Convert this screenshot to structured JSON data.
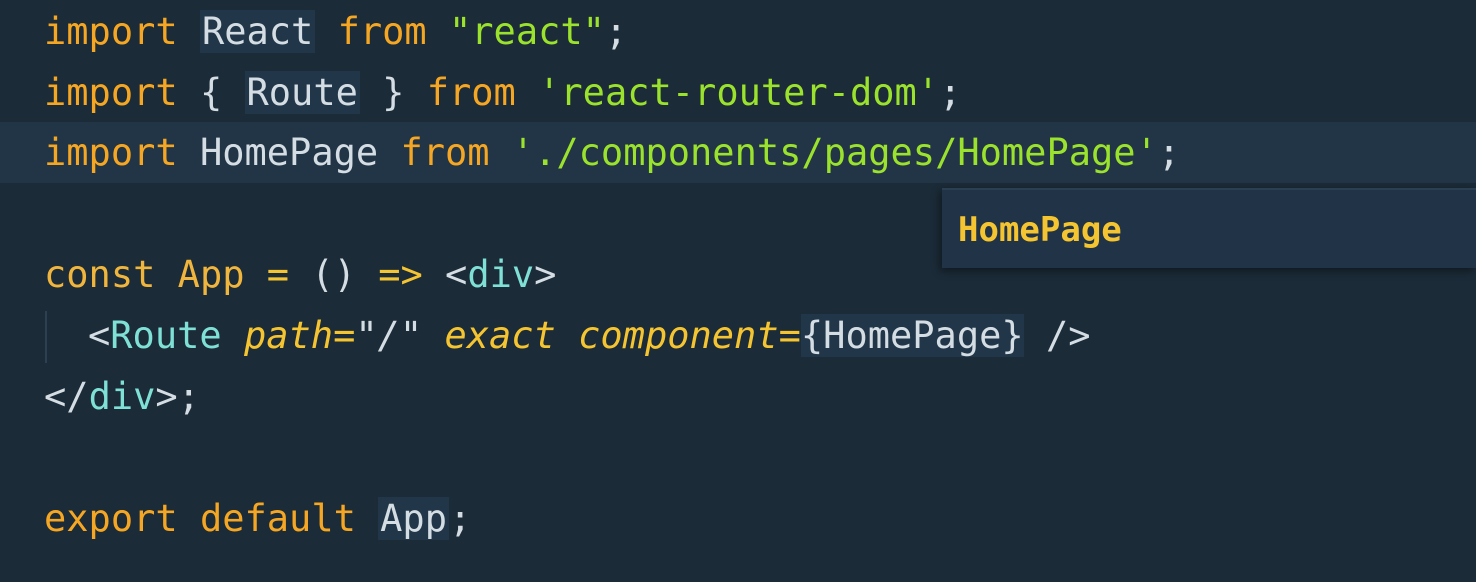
{
  "editor": {
    "lines": [
      {
        "tokens": [
          "import",
          " ",
          "React",
          " ",
          "from",
          " ",
          "\"react\"",
          ";"
        ]
      },
      {
        "tokens": [
          "import",
          " ",
          "{",
          " ",
          "Route",
          " ",
          "}",
          " ",
          "from",
          " ",
          "'react-router-dom'",
          ";"
        ]
      },
      {
        "tokens": [
          "import",
          " ",
          "HomePage",
          " ",
          "from",
          " ",
          "'./components/pages/HomePage'",
          ";"
        ]
      },
      {
        "tokens": []
      },
      {
        "tokens": [
          "const",
          " ",
          "App",
          " ",
          "=",
          " ",
          "()",
          " ",
          "=>",
          " ",
          "<",
          "div",
          ">"
        ]
      },
      {
        "tokens": [
          "<",
          "Route",
          " ",
          "path",
          "=",
          "\"/\"",
          " ",
          "exact",
          " ",
          "component",
          "=",
          "{",
          "HomePage",
          "}",
          " ",
          "/>"
        ]
      },
      {
        "tokens": [
          "</",
          "div",
          ">",
          ";"
        ]
      },
      {
        "tokens": []
      },
      {
        "tokens": [
          "export",
          " ",
          "default",
          " ",
          "App",
          ";"
        ]
      }
    ]
  },
  "suggestion": {
    "label": "HomePage"
  },
  "colors": {
    "background": "#1b2b38",
    "current_line": "#223546",
    "keyword": "#f5a623",
    "string": "#9be22d",
    "tag": "#7fe0d6",
    "attribute": "#f5c431",
    "identifier": "#d5dde4",
    "suggest_bg": "#213447"
  }
}
